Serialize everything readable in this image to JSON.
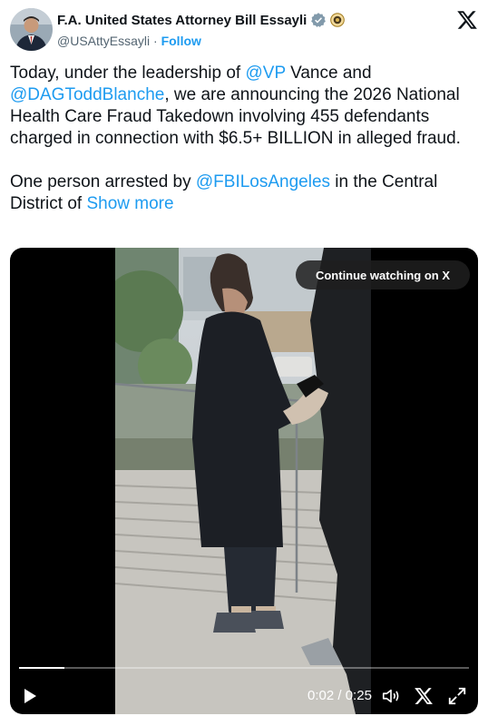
{
  "tweet": {
    "author_name": "F.A. United States Attorney Bill Essayli",
    "handle": "@USAttyEssayli",
    "separator": "·",
    "follow_label": "Follow",
    "para1": [
      {
        "t": "Today, under the leadership of ",
        "m": false
      },
      {
        "t": "@VP",
        "m": true
      },
      {
        "t": " Vance and ",
        "m": false
      },
      {
        "t": "@DAGToddBlanche",
        "m": true
      },
      {
        "t": ", we are announcing the 2026 National Health Care Fraud Takedown involving 455 defendants charged in connection with $6.5+ BILLION in alleged fraud.",
        "m": false
      }
    ],
    "para2": [
      {
        "t": "One person arrested by ",
        "m": false
      },
      {
        "t": "@FBILosAngeles",
        "m": true
      },
      {
        "t": " in the Central District of ",
        "m": false
      },
      {
        "t": "Show more",
        "m": true
      }
    ]
  },
  "video": {
    "continue_label": "Continue watching on X",
    "time_current": "0:02",
    "time_separator": "/",
    "time_total": "0:25",
    "progress": 0.1
  },
  "icons": {
    "verified": "verified-badge-icon",
    "seal": "government-seal-icon",
    "logo": "x-logo-icon",
    "play": "play-icon",
    "volume": "volume-icon",
    "x_small": "x-logo-icon",
    "fullscreen": "fullscreen-icon"
  },
  "colors": {
    "link": "#1d9bf0",
    "text": "#0f1419",
    "muted": "#536471",
    "video_bg": "#000000"
  }
}
